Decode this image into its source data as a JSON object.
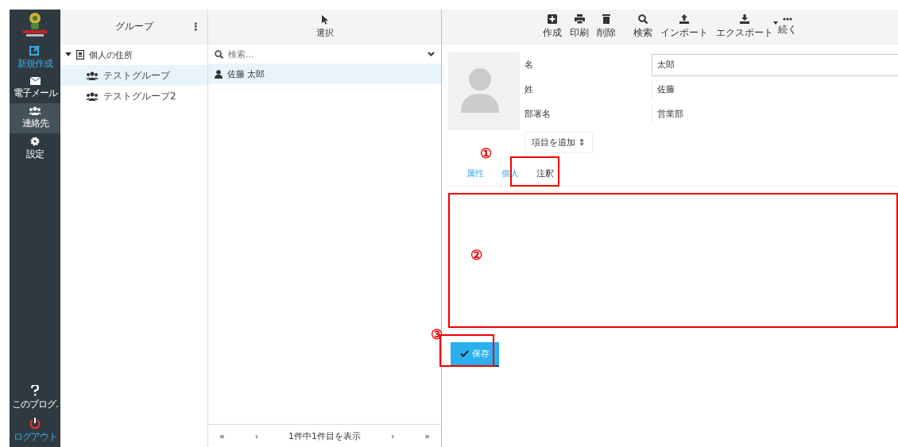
{
  "sidebar": {
    "items": [
      {
        "kind": "compose",
        "label": "新規作成",
        "selected": false
      },
      {
        "kind": "mail",
        "label": "電子メール",
        "selected": false
      },
      {
        "kind": "contacts",
        "label": "連絡先",
        "selected": true
      },
      {
        "kind": "settings",
        "label": "設定",
        "selected": false
      }
    ],
    "bottom_items": [
      {
        "kind": "help",
        "label": "このブログ."
      },
      {
        "kind": "logout",
        "label": "ログアウト"
      }
    ]
  },
  "groups": {
    "title": "グループ",
    "menu_icon": "⋮",
    "tree": [
      {
        "label": "個人の住所",
        "expanded": true,
        "selected": false,
        "children": [
          {
            "label": "テストグループ",
            "selected": true
          },
          {
            "label": "テストグループ2",
            "selected": false
          }
        ]
      }
    ]
  },
  "contacts": {
    "header": "選択",
    "search": {
      "placeholder": "検索..."
    },
    "rows": [
      {
        "name": "佐藤 太郎",
        "selected": true
      }
    ],
    "pager": {
      "first": "«",
      "prev": "‹",
      "status": "1件中1件目を表示",
      "next": "›",
      "last": "»"
    }
  },
  "toolbar": [
    {
      "kind": "create",
      "label": "作成"
    },
    {
      "kind": "print",
      "label": "印刷"
    },
    {
      "kind": "delete",
      "label": "削除"
    },
    {
      "kind": "search",
      "label": "検索"
    },
    {
      "kind": "import",
      "label": "インポート"
    },
    {
      "kind": "export",
      "label": "エクスポート"
    },
    {
      "kind": "more",
      "label": "続く"
    }
  ],
  "contact": {
    "fields": [
      {
        "label": "名",
        "value": "太郎"
      },
      {
        "label": "姓",
        "value": "佐藤"
      },
      {
        "label": "部署名",
        "value": "営業部"
      }
    ],
    "add_field": "項目を追加 ⇕",
    "tabs": [
      {
        "label": "属性",
        "selected": false
      },
      {
        "label": "個人",
        "selected": false
      },
      {
        "label": "注釈",
        "selected": true
      }
    ],
    "save": "保存",
    "tab_marker": "①",
    "note_marker": "②",
    "save_marker": "③"
  }
}
